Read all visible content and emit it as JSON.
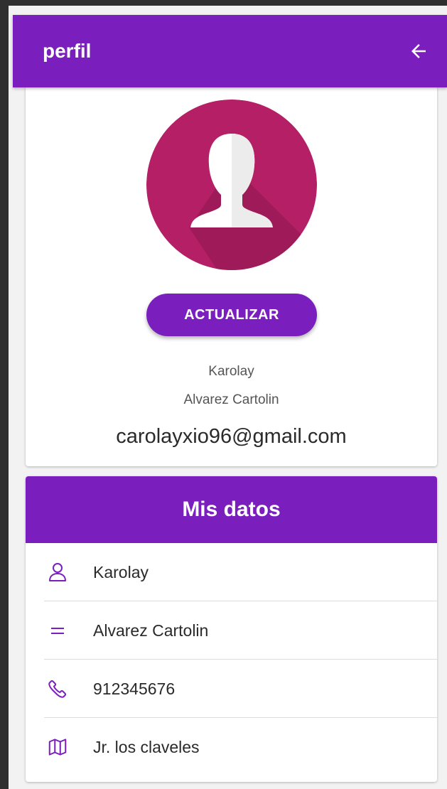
{
  "topbar": {
    "title": "perfil",
    "back_icon": "arrow-left-icon"
  },
  "profile": {
    "avatar_icon": "user-silhouette-icon",
    "update_button_label": "ACTUALIZAR",
    "first_name": "Karolay",
    "last_name": "Alvarez Cartolin",
    "email": "carolayxio96@gmail.com"
  },
  "my_data": {
    "header": "Mis datos",
    "rows": [
      {
        "icon": "person-icon",
        "value": "Karolay"
      },
      {
        "icon": "equals-icon",
        "value": "Alvarez Cartolin"
      },
      {
        "icon": "phone-icon",
        "value": "912345676"
      },
      {
        "icon": "map-icon",
        "value": "Jr. los claveles"
      }
    ]
  },
  "colors": {
    "primary": "#7a1fbd",
    "avatar_bg": "#b51f66",
    "text_dark": "#2a2a2a",
    "text_muted": "#555555"
  }
}
